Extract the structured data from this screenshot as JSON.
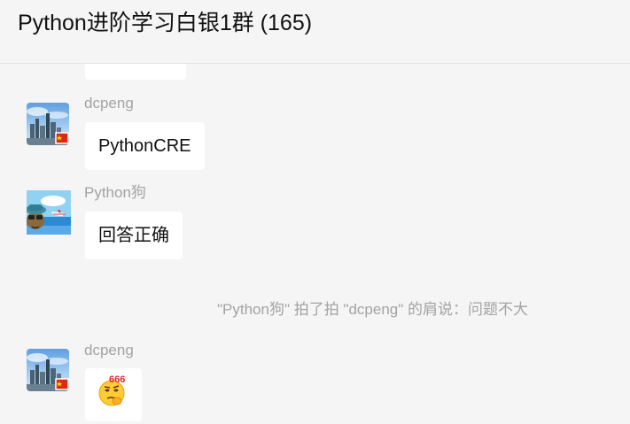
{
  "header": {
    "title": "Python进阶学习白银1群 (165)"
  },
  "messages": [
    {
      "sender": "dcpeng",
      "text": "PythonCRE",
      "avatar": "city-skyline-avatar"
    },
    {
      "sender": "Python狗",
      "text": "回答正确",
      "avatar": "cartoon-beach-avatar"
    },
    {
      "sender": "dcpeng",
      "emoji": {
        "name": "thinking-666-emoji",
        "label": "666"
      },
      "avatar": "city-skyline-avatar"
    }
  ],
  "system": {
    "pat_text": "\"Python狗\" 拍了拍 \"dcpeng\" 的肩说：问题不大"
  },
  "colors": {
    "background": "#f5f5f5",
    "bubble": "#ffffff",
    "sender_text": "#a3a3a3",
    "flag_red": "#de2910"
  }
}
